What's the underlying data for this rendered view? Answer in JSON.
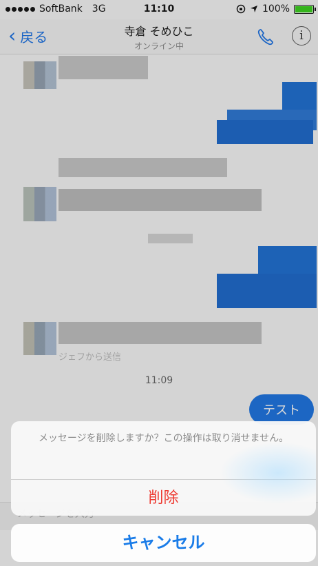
{
  "status_bar": {
    "carrier": "SoftBank",
    "network": "3G",
    "time": "11:10",
    "battery": "100%",
    "icons": [
      "lock-rotation-icon",
      "location-arrow-icon",
      "battery-icon"
    ]
  },
  "nav": {
    "back_label": "戻る",
    "contact_name": "寺倉 そめひこ",
    "status": "オンライン中",
    "icons": [
      "chevron-left-icon",
      "phone-icon",
      "info-icon"
    ]
  },
  "chat": {
    "timestamp": "11:09",
    "my_message": "テスト",
    "partial_text": "ジェフから送信"
  },
  "input": {
    "placeholder": "メッセージを入力"
  },
  "action_sheet": {
    "message": "メッセージを削除しますか？この操作は取り消せません。",
    "delete_label": "削除",
    "cancel_label": "キャンセル"
  },
  "colors": {
    "accent_blue": "#1a7ce8",
    "destructive_red": "#ee3b32",
    "bubble_blue": "#1a75e6",
    "battery_green": "#38d31a"
  }
}
